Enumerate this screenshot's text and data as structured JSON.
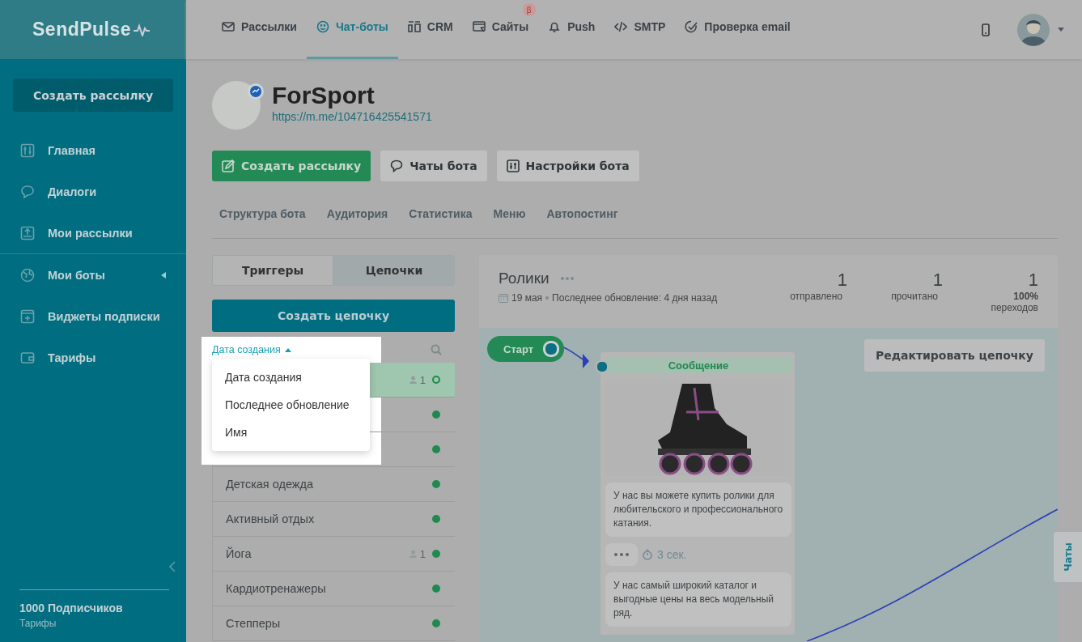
{
  "brand": {
    "name": "SendPulse"
  },
  "sidebar": {
    "create_button": "Создать рассылку",
    "items": [
      {
        "label": "Главная"
      },
      {
        "label": "Диалоги"
      },
      {
        "label": "Мои рассылки"
      },
      {
        "label": "Мои боты",
        "expanded": false
      },
      {
        "label": "Виджеты подписки"
      },
      {
        "label": "Тарифы"
      }
    ],
    "subscribers": "1000 Подписчиков",
    "plan_link": "Тарифы"
  },
  "topnav": [
    {
      "label": "Рассылки",
      "selected": false
    },
    {
      "label": "Чат-боты",
      "selected": true
    },
    {
      "label": "CRM",
      "selected": false
    },
    {
      "label": "Сайты",
      "selected": false,
      "badge": "β"
    },
    {
      "label": "Push",
      "selected": false
    },
    {
      "label": "SMTP",
      "selected": false
    },
    {
      "label": "Проверка email",
      "selected": false
    }
  ],
  "bot": {
    "name": "ForSport",
    "link": "https://m.me/104716425541571",
    "actions": [
      {
        "label": "Создать рассылку",
        "kind": "primary"
      },
      {
        "label": "Чаты бота",
        "kind": "chat"
      },
      {
        "label": "Настройки бота",
        "kind": "settings"
      }
    ],
    "tabs": [
      {
        "label": "Структура бота",
        "selected": false
      },
      {
        "label": "Аудитория",
        "selected": false
      },
      {
        "label": "Статистика",
        "selected": false
      },
      {
        "label": "Меню",
        "selected": false
      },
      {
        "label": "Автопостинг",
        "selected": false
      }
    ]
  },
  "segments": [
    {
      "label": "Триггеры",
      "selected": false
    },
    {
      "label": "Цепочки",
      "selected": true
    }
  ],
  "create_chain_button": "Создать цепочку",
  "sort": {
    "label": "Дата создания",
    "expanded": true,
    "options": [
      "Дата создания",
      "Последнее обновление",
      "Имя"
    ]
  },
  "chains": [
    {
      "subscribers": "1",
      "active": false,
      "selected": true
    },
    {
      "active": true,
      "selected": false
    },
    {
      "active": true,
      "selected": false
    },
    {
      "name": "Детская одежда",
      "active": true,
      "selected": false
    },
    {
      "name": "Активный отдых",
      "active": true,
      "selected": false
    },
    {
      "name": "Йога",
      "subscribers": "1",
      "active": true,
      "selected": false
    },
    {
      "name": "Кардиотренажеры",
      "active": true,
      "selected": false
    },
    {
      "name": "Степперы",
      "active": true,
      "selected": false
    }
  ],
  "chain": {
    "title": "Ролики",
    "date": "19 мая",
    "updated": "Последнее обновление: 4 дня назад",
    "stats": [
      {
        "value": "1",
        "label": "отправлено"
      },
      {
        "value": "1",
        "label": "прочитано"
      },
      {
        "value": "1",
        "rate": "100%",
        "label": "переходов"
      }
    ],
    "start": "Старт",
    "edit_button": "Редактировать цепочку",
    "message": {
      "title": "Сообщение",
      "texts": [
        "У нас вы можете купить ролики для любительского и профессионального катания.",
        "У нас самый широкий каталог и выгодные цены на весь модельный ряд."
      ],
      "delay": "3 сек."
    }
  },
  "chats_tab": "Чаты"
}
